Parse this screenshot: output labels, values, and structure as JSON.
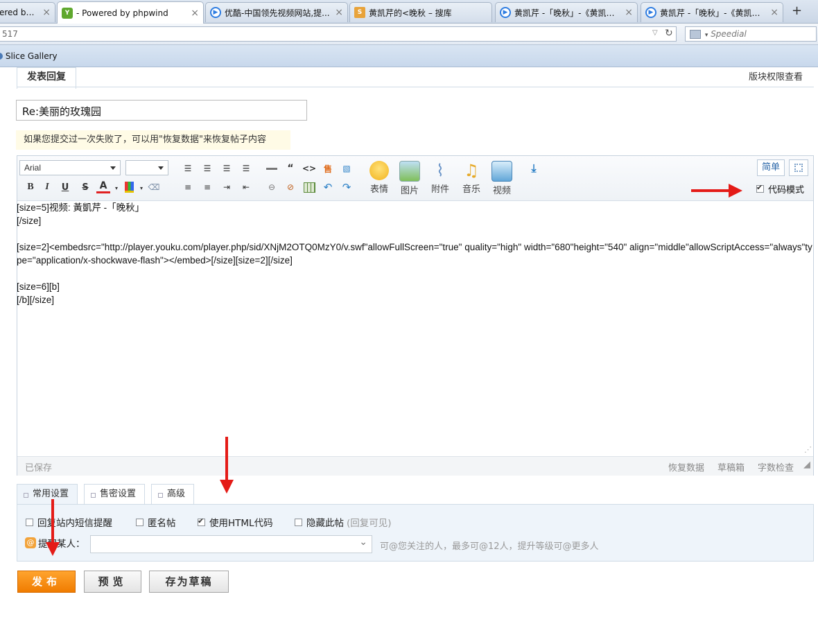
{
  "browser": {
    "tabs": [
      {
        "label": "ered by ...",
        "active": false,
        "icon": "page-icon",
        "color": "#7aa0cf"
      },
      {
        "label": "- Powered by phpwind",
        "active": true,
        "icon": "phpwind-icon",
        "color": "#5fa82e"
      },
      {
        "label": "优酷-中国领先视频网站,提...",
        "active": false,
        "icon": "youku-icon",
        "color": "#2f7de1"
      },
      {
        "label": "黄凯芹的<晚秋 – 搜库",
        "active": false,
        "icon": "soku-icon",
        "color": "#e8a33a"
      },
      {
        "label": "黄凯芹 -「晚秋」-《黄凯芹好...",
        "active": false,
        "icon": "youku-icon",
        "color": "#2f7de1"
      },
      {
        "label": "黄凯芹 -「晚秋」-《黄凯芹好...",
        "active": false,
        "icon": "youku-icon",
        "color": "#2f7de1"
      }
    ],
    "new_tab": "+",
    "url": "517",
    "search_placeholder": "Speedial",
    "bookmark": "Slice Gallery"
  },
  "page": {
    "tab_label": "发表回复",
    "permission_link": "版块权限查看",
    "title_value": "Re:美丽的玫瑰园",
    "tip": "如果您提交过一次失败了，可以用\"恢复数据\"来恢复帖子内容"
  },
  "toolbar": {
    "font_select": "Arial",
    "size_select": "",
    "big_buttons": [
      {
        "label": "表情",
        "icon": "smiley-icon",
        "color": "#f7c531"
      },
      {
        "label": "图片",
        "icon": "image-icon",
        "color": "#7fbf5a"
      },
      {
        "label": "附件",
        "icon": "attachment-icon",
        "color": "#6c95c8"
      },
      {
        "label": "音乐",
        "icon": "music-icon",
        "color": "#e6a928"
      },
      {
        "label": "视频",
        "icon": "video-icon",
        "color": "#62a6d8"
      }
    ],
    "simple_label": "简单",
    "code_mode_label": "代码模式",
    "code_mode_checked": true
  },
  "editor": {
    "lines": [
      "[size=5]视频: 黃凱芹 -「晚秋」",
      "[/size]",
      "",
      "[size=2]<embedsrc=\"http://player.youku.com/player.php/sid/XNjM2OTQ0MzY0/v.swf\"allowFullScreen=\"true\" quality=\"high\" width=\"680\"height=\"540\" align=\"middle\"allowScriptAccess=\"always\"type=\"application/x-shockwave-flash\"></embed>[/size][size=2][/size]",
      "",
      "[size=6][b]",
      "[/b][/size]"
    ],
    "saved_status": "已保存",
    "restore_link": "恢复数据",
    "drafts_link": "草稿箱",
    "wordcount_link": "字数检查"
  },
  "settings": {
    "tabs": [
      "常用设置",
      "售密设置",
      "高级"
    ],
    "options": [
      {
        "label": "回复站内短信提醒",
        "checked": false
      },
      {
        "label": "匿名帖",
        "checked": false
      },
      {
        "label": "使用HTML代码",
        "checked": true
      },
      {
        "label": "隐藏此帖",
        "checked": false,
        "note": "(回复可见)"
      }
    ],
    "mention_label": "提醒某人：",
    "mention_hint": "可@您关注的人，最多可@12人，提升等级可@更多人"
  },
  "actions": {
    "publish": "发布",
    "preview": "预览",
    "save_draft": "存为草稿"
  },
  "colors": {
    "arrow": "#e41b17",
    "publish_bg": "#f28a0e",
    "link_blue": "#2a66a8"
  }
}
